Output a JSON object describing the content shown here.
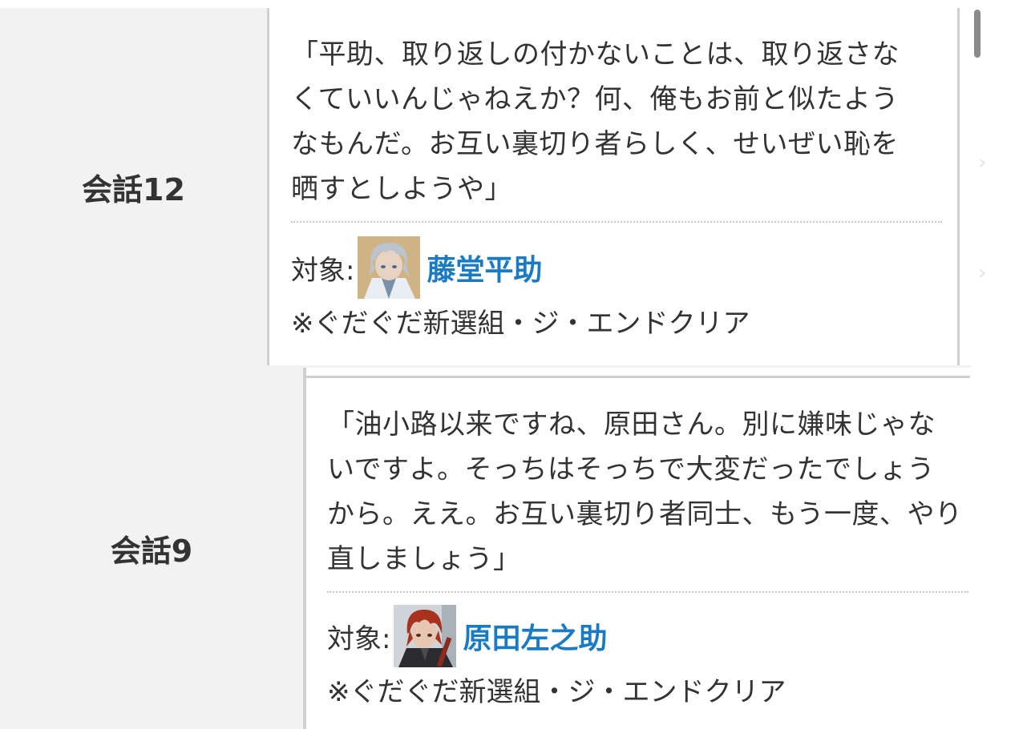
{
  "cards": [
    {
      "label": "会話12",
      "quote_lines": [
        "「平助、取り返しの付かないことは、取り返さな",
        "くていいんじゃねえか？何、俺もお前と似たよう",
        "なもんだ。お互い裏切り者らしく、せいぜい恥を",
        "晒すとしようや」"
      ],
      "target_prefix": "対象:",
      "character": "藤堂平助",
      "note": "※ぐだぐだ新選組・ジ・エンドクリア",
      "avatar_colors": {
        "hair": "#b9c4cf",
        "skin": "#e8d3c3",
        "bg": "#c9a26a",
        "cloth": "#e8eef4"
      }
    },
    {
      "label": "会話9",
      "quote_lines": [
        "「油小路以来ですね、原田さん。別に嫌味じゃな",
        "いですよ。そっちはそっちで大変だったでしょう",
        "から。ええ。お互い裏切り者同士、もう一度、やり",
        "直しましょう」"
      ],
      "target_prefix": "対象:",
      "character": "原田左之助",
      "note": "※ぐだぐだ新選組・ジ・エンドクリア",
      "avatar_colors": {
        "hair": "#a8321e",
        "skin": "#e6c7b1",
        "bg": "#cfd4d8",
        "cloth": "#2b2b2e"
      }
    }
  ],
  "colors": {
    "link": "#1a7bc4",
    "label_bg": "#f2f2f2",
    "text": "#333333",
    "border": "#d0d0d0"
  }
}
